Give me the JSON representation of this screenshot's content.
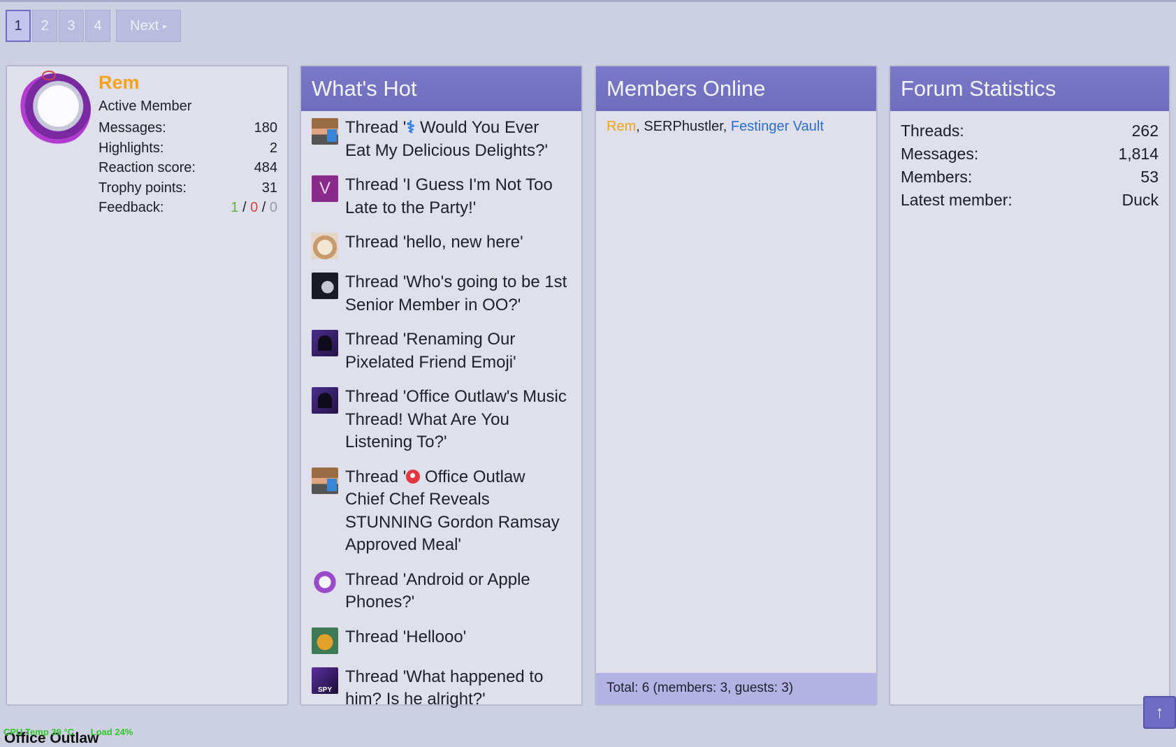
{
  "pagination": {
    "pages": [
      "1",
      "2",
      "3",
      "4"
    ],
    "active": "1",
    "next_label": "Next",
    "next_caret": "▸"
  },
  "member_card": {
    "name": "Rem",
    "title": "Active Member",
    "stats": [
      {
        "label": "Messages:",
        "value": "180"
      },
      {
        "label": "Highlights:",
        "value": "2"
      },
      {
        "label": "Reaction score:",
        "value": "484"
      },
      {
        "label": "Trophy points:",
        "value": "31"
      }
    ],
    "feedback": {
      "label": "Feedback:",
      "positive": "1",
      "neutral": "0",
      "negative": "0",
      "separator": "/"
    }
  },
  "whats_hot": {
    "title": "What's Hot",
    "items": [
      {
        "prefix": "Thread '",
        "emoji": "⚕",
        "text": " Would You Ever Eat My Delicious Delights?'"
      },
      {
        "prefix": "Thread 'I Guess I'm Not Too Late to the Party!'",
        "emoji": "",
        "text": ""
      },
      {
        "prefix": "Thread 'hello, new here'",
        "emoji": "",
        "text": ""
      },
      {
        "prefix": "Thread 'Who's going to be 1st Senior Member in OO?'",
        "emoji": "",
        "text": ""
      },
      {
        "prefix": "Thread 'Renaming Our Pixelated Friend Emoji'",
        "emoji": "",
        "text": ""
      },
      {
        "prefix": "Thread 'Office Outlaw's Music Thread! What Are You Listening To?'",
        "emoji": "",
        "text": ""
      },
      {
        "prefix": "Thread '",
        "emoji": "meat",
        "text": " Office Outlaw Chief Chef Reveals STUNNING Gordon Ramsay Approved Meal'"
      },
      {
        "prefix": "Thread 'Android or Apple Phones?'",
        "emoji": "",
        "text": ""
      },
      {
        "prefix": "Thread 'Hellooo'",
        "emoji": "",
        "text": ""
      },
      {
        "prefix": "Thread 'What happened to him? Is he alright?'",
        "emoji": "",
        "text": ""
      }
    ],
    "avatar_letter": "V",
    "avatar_spy_text": "SPY"
  },
  "members_online": {
    "title": "Members Online",
    "members": [
      "Rem",
      "SERPhustler",
      "Festinger Vault"
    ],
    "separator": ", ",
    "total": "Total: 6 (members: 3, guests: 3)"
  },
  "forum_statistics": {
    "title": "Forum Statistics",
    "rows": [
      {
        "label": "Threads:",
        "value": "262"
      },
      {
        "label": "Messages:",
        "value": "1,814"
      },
      {
        "label": "Members:",
        "value": "53"
      },
      {
        "label": "Latest member:",
        "value": "Duck"
      }
    ]
  },
  "scroll_top_icon": "↑",
  "overlay": {
    "cpu_temp": "CPU Temp 39 °C",
    "load": "Load 24%",
    "breadcrumb": "Office Outlaw"
  },
  "colors": {
    "accent": "#6f6cbd",
    "username": "#f4a31a",
    "link": "#2b6dd1",
    "feedback_positive": "#5fb43a",
    "feedback_neutral": "#d04545"
  }
}
